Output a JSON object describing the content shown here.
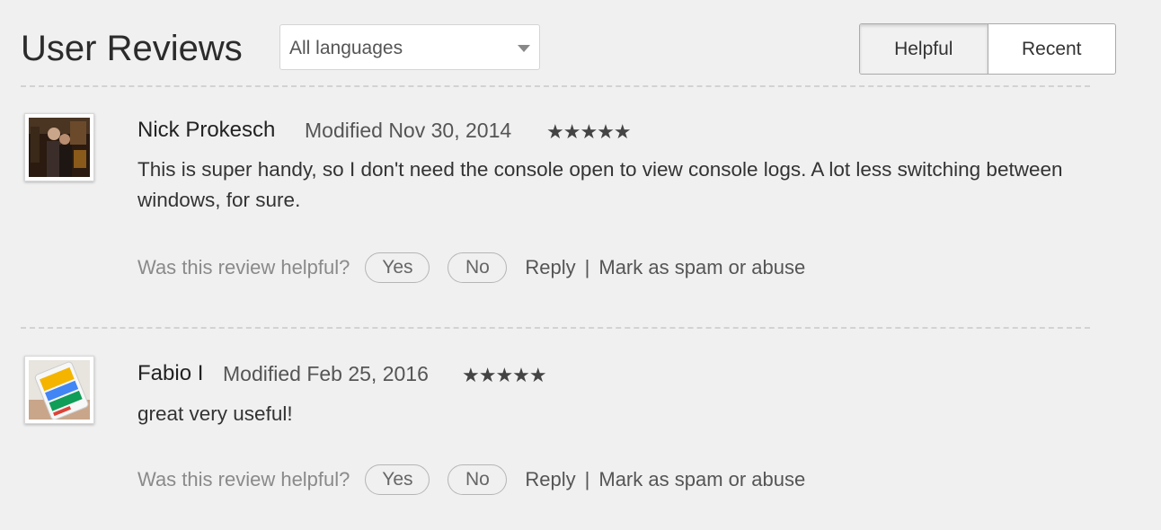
{
  "header": {
    "title": "User Reviews",
    "language_select": {
      "value": "All languages"
    },
    "sort_tabs": [
      {
        "label": "Helpful",
        "active": true
      },
      {
        "label": "Recent",
        "active": false
      }
    ]
  },
  "reviews": [
    {
      "author": "Nick Prokesch",
      "modified": "Modified Nov 30, 2014",
      "stars": "★★★★★",
      "rating": 5,
      "text": "This is super handy, so I don't need the console open to view console logs. A lot less switching between windows, for sure.",
      "helpful_question": "Was this review helpful?",
      "yes_label": "Yes",
      "no_label": "No",
      "reply_label": "Reply",
      "separator": "|",
      "spam_label": "Mark as spam or abuse"
    },
    {
      "author": "Fabio I",
      "modified": "Modified Feb 25, 2016",
      "stars": "★★★★★",
      "rating": 5,
      "text": "great very useful!",
      "helpful_question": "Was this review helpful?",
      "yes_label": "Yes",
      "no_label": "No",
      "reply_label": "Reply",
      "separator": "|",
      "spam_label": "Mark as spam or abuse"
    }
  ],
  "colors": {
    "background": "#f0f0f0",
    "star": "#444444",
    "muted_text": "#8a8a8a"
  }
}
